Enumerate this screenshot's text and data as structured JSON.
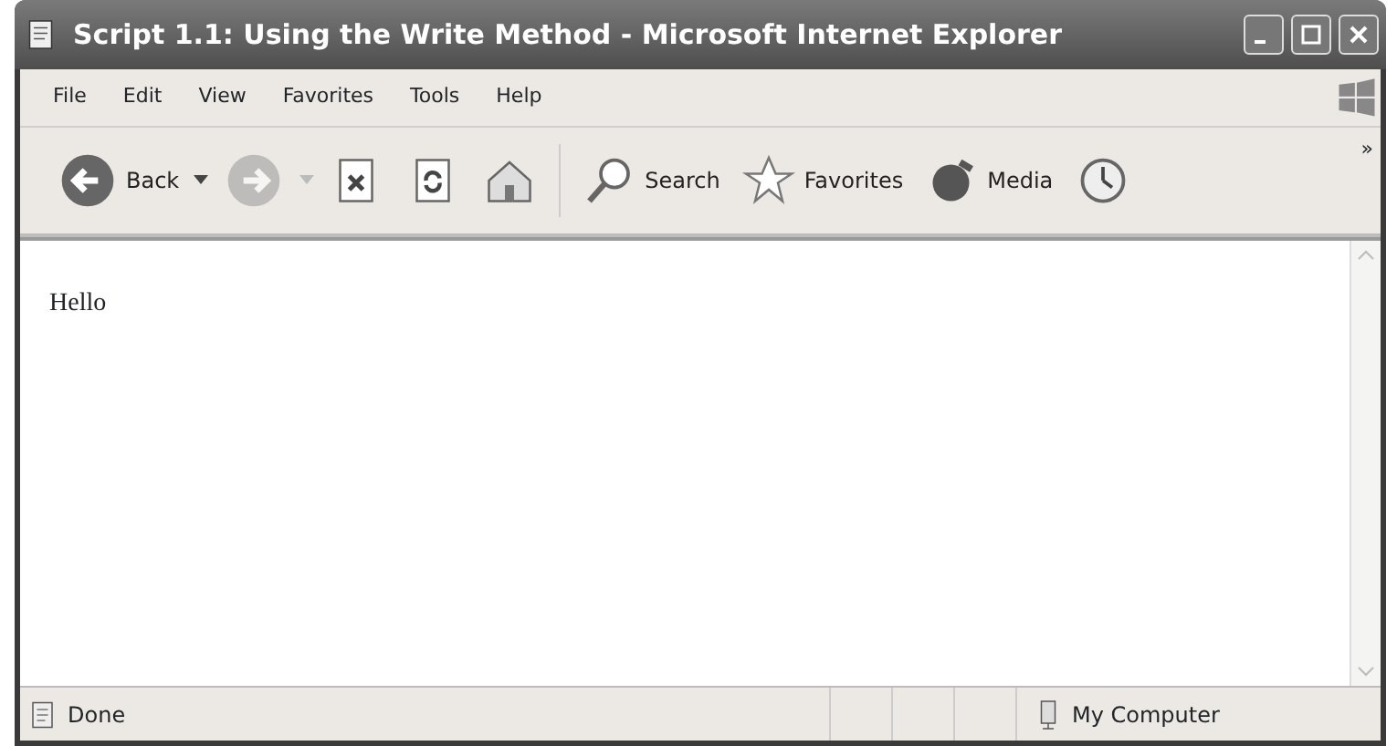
{
  "window": {
    "title": "Script 1.1: Using the Write Method - Microsoft Internet Explorer"
  },
  "menu": [
    "File",
    "Edit",
    "View",
    "Favorites",
    "Tools",
    "Help"
  ],
  "toolbar": [
    {
      "kind": "back",
      "label": "Back",
      "disabled": false
    },
    {
      "kind": "forward",
      "disabled": true
    },
    {
      "kind": "stop"
    },
    {
      "kind": "refresh"
    },
    {
      "kind": "home"
    },
    {
      "kind": "search",
      "label": "Search"
    },
    {
      "kind": "favorites",
      "label": "Favorites"
    },
    {
      "kind": "media",
      "label": "Media"
    },
    {
      "kind": "history"
    }
  ],
  "toolbar_overflow": "»",
  "content": {
    "text": "Hello"
  },
  "status_bar": {
    "text": "Done",
    "zone": "My Computer"
  }
}
